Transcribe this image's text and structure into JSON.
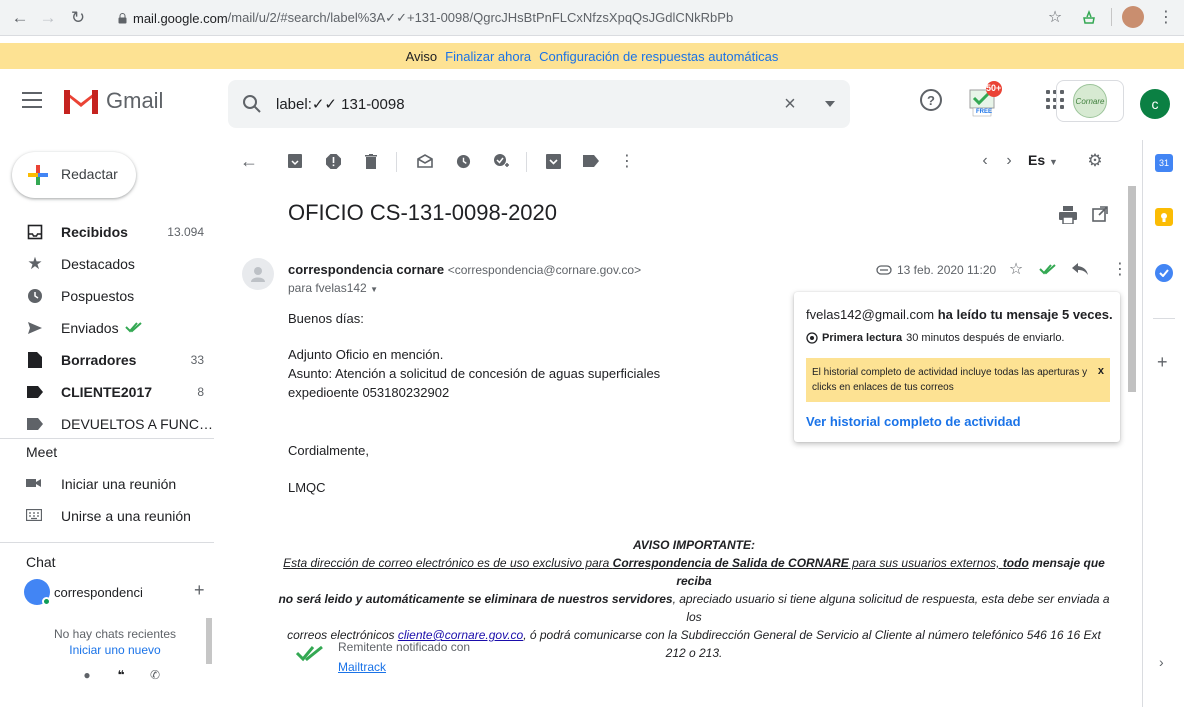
{
  "browser": {
    "url_host": "mail.google.com",
    "url_path": "/mail/u/2/#search/label%3A✓✓+131-0098/QgrcJHsBtPnFLCxNfzsXpqQsJGdlCNkRbPb"
  },
  "notice": {
    "label": "Aviso",
    "finish_link": "Finalizar ahora",
    "config_link": "Configuración de respuestas automáticas"
  },
  "header": {
    "product_name": "Gmail",
    "search_value": "label:✓✓ 131-0098",
    "mailtrack_badge": "50+",
    "mailtrack_free": "FREE",
    "org_logo_text": "Cornare",
    "avatar_letter": "c"
  },
  "sidebar": {
    "compose_label": "Redactar",
    "items": [
      {
        "label": "Recibidos",
        "count": "13.094",
        "bold": true
      },
      {
        "label": "Destacados",
        "count": ""
      },
      {
        "label": "Pospuestos",
        "count": ""
      },
      {
        "label": "Enviados",
        "count": ""
      },
      {
        "label": "Borradores",
        "count": "33",
        "bold": true
      },
      {
        "label": "CLIENTE2017",
        "count": "8",
        "bold": true
      },
      {
        "label": "DEVUELTOS A FUNCION...",
        "count": ""
      }
    ],
    "meet_title": "Meet",
    "meet_items": [
      "Iniciar una reunión",
      "Unirse a una reunión"
    ],
    "chat_title": "Chat",
    "chat_user": "correspondenci",
    "no_chats": "No hay chats recientes",
    "start_chat": "Iniciar uno nuevo"
  },
  "toolbar": {
    "language": "Es"
  },
  "email": {
    "subject": "OFICIO CS-131-0098-2020",
    "sender_name": "correspondencia cornare",
    "sender_email": "<correspondencia@cornare.gov.co>",
    "recipient": "para fvelas142",
    "date": "13 feb. 2020 11:20",
    "greeting": "Buenos días:",
    "line1": "Adjunto Oficio en mención.",
    "line2": "Asunto: Atención a solicitud de concesión de aguas superficiales",
    "line3": "expedioente 053180232902",
    "closing": "Cordialmente,",
    "signature": "LMQC",
    "disclaimer": {
      "title": "AVISO IMPORTANTE:",
      "p1a": "Esta dirección de correo electrónico es de uso exclusivo para ",
      "p1b": "Correspondencia de Salida de CORNARE",
      "p1c": " para sus usuarios externos, ",
      "p1d": "todo",
      "p1e": " mensaje que reciba",
      "p2a": "no será leido y automáticamente se eliminara de nuestros servidores",
      "p2b": ", apreciado usuario si tiene alguna solicitud  de respuesta, esta debe ser enviada a los",
      "p3a": "correos electrónicos ",
      "p3b": "cliente@cornare.gov.co",
      "p3c": ", ó podrá comunicarse con la Subdirección General de Servicio al Cliente al número telefónico 546 16 16 Ext 212 o 213."
    },
    "mailtrack_notified": "Remitente notificado con",
    "mailtrack_link": "Mailtrack"
  },
  "popup": {
    "address": "fvelas142@gmail.com",
    "read_text": "ha leído tu mensaje 5 veces.",
    "first_read_label": "Primera lectura",
    "first_read_time": "30 minutos después de enviarlo.",
    "note": "El historial completo de actividad incluye todas las aperturas y clicks en enlaces de tus correos",
    "note_close": "x",
    "history_link": "Ver historial completo de actividad"
  },
  "side_panel": {
    "calendar_day": "31"
  },
  "colors": {
    "notice_bg": "#fde293",
    "link_blue": "#1a73e8",
    "mailtrack_green": "#34a853",
    "avatar_green": "#0b8043"
  }
}
